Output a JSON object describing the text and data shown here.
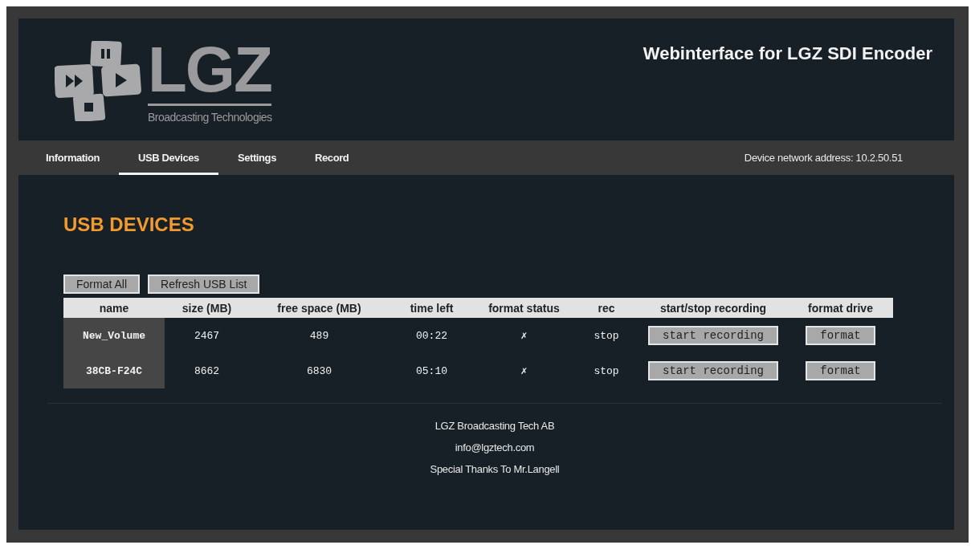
{
  "logo": {
    "wordmark": "LGZ",
    "tagline": "Broadcasting Technologies"
  },
  "header": {
    "title": "Webinterface for LGZ SDI Encoder"
  },
  "tabs": [
    {
      "label": "Information",
      "selected": false
    },
    {
      "label": "USB Devices",
      "selected": true
    },
    {
      "label": "Settings",
      "selected": false
    },
    {
      "label": "Record",
      "selected": false
    }
  ],
  "network_address": "Device network address: 10.2.50.51",
  "page_title": "USB DEVICES",
  "actions": [
    "Format All",
    "Refresh USB List"
  ],
  "table": {
    "columns": [
      "name",
      "size (MB)",
      "free space (MB)",
      "time left",
      "format status",
      "rec",
      "start/stop recording",
      "format drive"
    ],
    "rows": [
      {
        "name": "New_Volume",
        "size": "2467",
        "free_space": "489",
        "time_left": "00:22",
        "format_status": "✗",
        "rec": "stop",
        "record_button": "start recording",
        "format_button": "format"
      },
      {
        "name": "38CB-F24C",
        "size": "8662",
        "free_space": "6830",
        "time_left": "05:10",
        "format_status": "✗",
        "rec": "stop",
        "record_button": "start recording",
        "format_button": "format"
      }
    ]
  },
  "footer": [
    "LGZ Broadcasting Tech AB",
    "info@lgztech.com",
    "Special Thanks To Mr.Langell"
  ]
}
